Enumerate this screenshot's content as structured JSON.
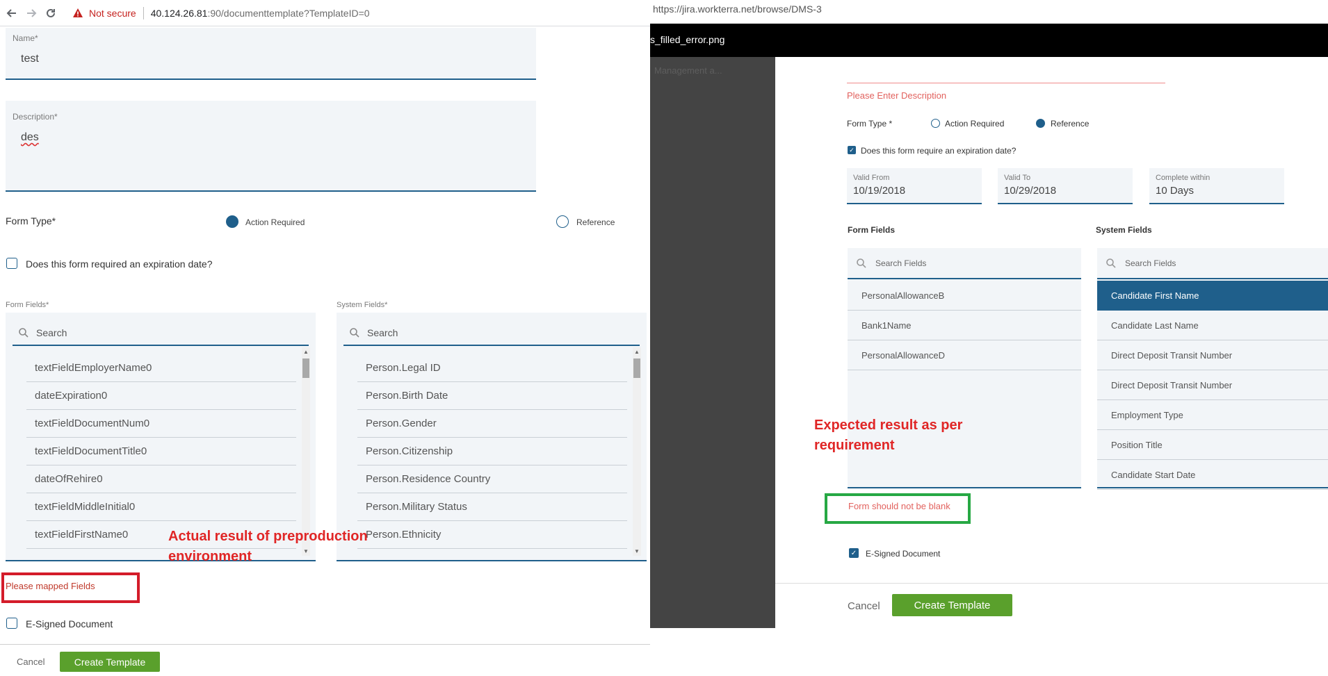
{
  "left": {
    "browser": {
      "security_label": "Not secure",
      "host": "40.124.26.81",
      "path": ":90/documenttemplate?TemplateID=0",
      "back_icon": "arrow-left-icon",
      "forward_icon": "arrow-right-icon",
      "reload_icon": "reload-icon"
    },
    "form": {
      "name_label": "Name*",
      "name_value": "test",
      "description_label": "Description*",
      "description_value": "des",
      "form_type_label": "Form Type*",
      "form_type_options": [
        {
          "label": "Action Required",
          "selected": true
        },
        {
          "label": "Reference",
          "selected": false
        }
      ],
      "expiration_label": "Does this form required an expiration date?",
      "expiration_checked": false,
      "form_fields_label": "Form Fields*",
      "system_fields_label": "System Fields*",
      "search_placeholder": "Search",
      "form_fields": [
        "textFieldEmployerName0",
        "dateExpiration0",
        "textFieldDocumentNum0",
        "textFieldDocumentTitle0",
        "dateOfRehire0",
        "textFieldMiddleInitial0",
        "textFieldFirstName0"
      ],
      "system_fields": [
        "Person.Legal ID",
        "Person.Birth Date",
        "Person.Gender",
        "Person.Citizenship",
        "Person.Residence Country",
        "Person.Military Status",
        "Person.Ethnicity"
      ],
      "error_text": "Please mapped Fields",
      "esigned_label": "E-Signed Document",
      "esigned_checked": false,
      "cancel_label": "Cancel",
      "create_label": "Create Template"
    },
    "annotation": {
      "line1": "Actual result of preproduction",
      "line2": "environment"
    }
  },
  "right": {
    "url": "https://jira.workterra.net/browse/DMS-3",
    "attachment_name": "s_filled_error.png",
    "sidebar_ghost": "Management a...",
    "form": {
      "description_error": "Please Enter Description",
      "form_type_label": "Form Type *",
      "form_type_options": [
        {
          "label": "Action Required",
          "selected": false
        },
        {
          "label": "Reference",
          "selected": true
        }
      ],
      "expiration_label": "Does this form require an expiration date?",
      "expiration_checked": true,
      "valid_from_label": "Valid From",
      "valid_from_value": "10/19/2018",
      "valid_to_label": "Valid To",
      "valid_to_value": "10/29/2018",
      "complete_within_label": "Complete within",
      "complete_within_value": "10 Days",
      "form_fields_label": "Form Fields",
      "system_fields_label": "System Fields",
      "search_placeholder": "Search Fields",
      "form_fields": [
        "PersonalAllowanceB",
        "Bank1Name",
        "PersonalAllowanceD"
      ],
      "system_fields": [
        {
          "label": "Candidate First Name",
          "selected": true
        },
        {
          "label": "Candidate Last Name",
          "selected": false
        },
        {
          "label": "Direct Deposit Transit Number",
          "selected": false
        },
        {
          "label": "Direct Deposit Transit Number",
          "selected": false
        },
        {
          "label": "Employment Type",
          "selected": false
        },
        {
          "label": "Position Title",
          "selected": false
        },
        {
          "label": "Candidate Start Date",
          "selected": false
        }
      ],
      "error_text": "Form should not be blank",
      "esigned_label": "E-Signed Document",
      "esigned_checked": true,
      "cancel_label": "Cancel",
      "create_label": "Create Template"
    },
    "annotation": {
      "line1": "Expected result as per",
      "line2": "requirement"
    }
  },
  "colors": {
    "accent_blue": "#1f5f8b",
    "button_green": "#5aa02c",
    "annotation_red": "#e02626",
    "error_box_red": "#d41c2a",
    "error_box_green": "#27a844"
  }
}
